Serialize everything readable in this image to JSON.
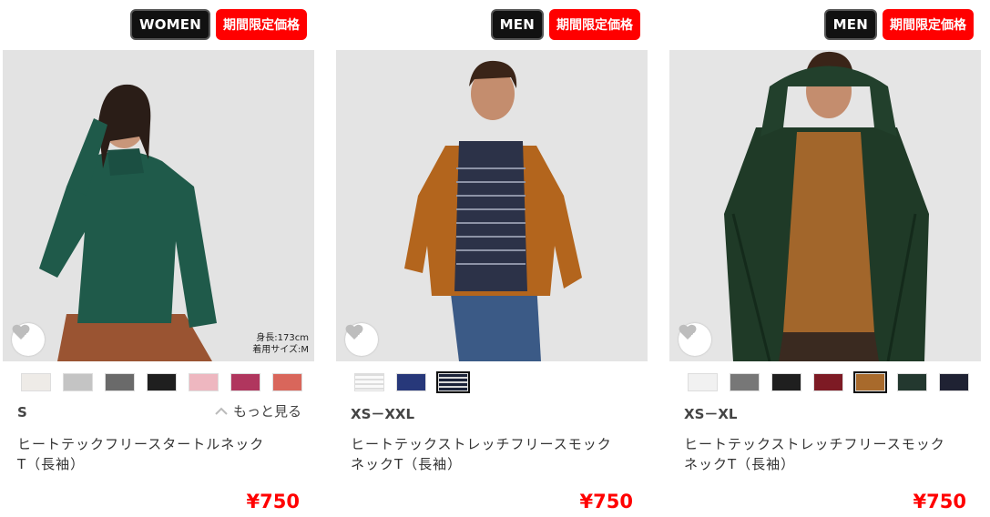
{
  "products": [
    {
      "gender": "WOMEN",
      "sale_tag": "期間限定価格",
      "model_height": "身長:173cm",
      "model_size": "着用サイズ:M",
      "colors": [
        "#eeebe7",
        "#c4c4c4",
        "#6a6a6a",
        "#1f1f1f",
        "#eeb7c0",
        "#b0365e",
        "#d9665b"
      ],
      "size_range": "S",
      "more_label": "もっと見る",
      "name_line1": "ヒートテックフリースタートルネック",
      "name_line2": "T（長袖）",
      "price": "¥750"
    },
    {
      "gender": "MEN",
      "sale_tag": "期間限定価格",
      "colors": [
        "stripe-light",
        "#27387a",
        "stripe-dark"
      ],
      "size_range": "XS－XXL",
      "name_line1": "ヒートテックストレッチフリースモック",
      "name_line2": "ネックT（長袖）",
      "price": "¥750"
    },
    {
      "gender": "MEN",
      "sale_tag": "期間限定価格",
      "colors": [
        "#f1f1f1",
        "#777777",
        "#1f1f1f",
        "#7d1a24",
        "#a86a2c",
        "#23382f",
        "#1f2233"
      ],
      "size_range": "XS－XL",
      "name_line1": "ヒートテックストレッチフリースモック",
      "name_line2": "ネックT（長袖）",
      "price": "¥750"
    }
  ]
}
